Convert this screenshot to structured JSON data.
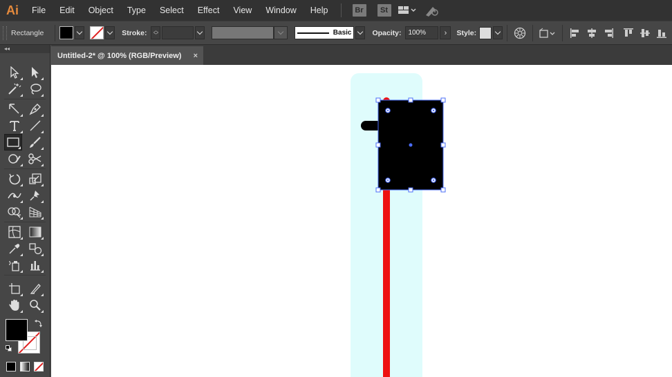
{
  "app": {
    "logo": "Ai"
  },
  "menu": [
    "File",
    "Edit",
    "Object",
    "Type",
    "Select",
    "Effect",
    "View",
    "Window",
    "Help"
  ],
  "apps": {
    "bridge": "Br",
    "stock": "St"
  },
  "control": {
    "tool_name": "Rectangle",
    "fill_color": "#000000",
    "stroke_label": "Stroke:",
    "brush_label": "Basic",
    "opacity_label": "Opacity:",
    "opacity_value": "100%",
    "style_label": "Style:"
  },
  "tabs": [
    {
      "label": "Untitled-2* @ 100% (RGB/Preview)",
      "close": "×"
    }
  ],
  "colors": {
    "artboard_bg": "#dffcfc",
    "red": "#ee1111",
    "selection": "#4a6cf7",
    "accent_logo": "#e58a3c"
  },
  "icons": [
    "selection-icon",
    "direct-selection-icon",
    "magic-wand-icon",
    "lasso-icon",
    "pen-icon",
    "curvature-icon",
    "type-icon",
    "line-segment-icon",
    "rectangle-icon",
    "paintbrush-icon",
    "shaper-icon",
    "scissors-icon",
    "rotate-icon",
    "scale-icon",
    "width-icon",
    "puppet-warp-icon",
    "shape-builder-icon",
    "perspective-grid-icon",
    "mesh-icon",
    "gradient-icon",
    "eyedropper-icon",
    "blend-icon",
    "symbol-sprayer-icon",
    "column-graph-icon",
    "artboard-icon",
    "slice-icon",
    "hand-icon",
    "zoom-icon"
  ]
}
